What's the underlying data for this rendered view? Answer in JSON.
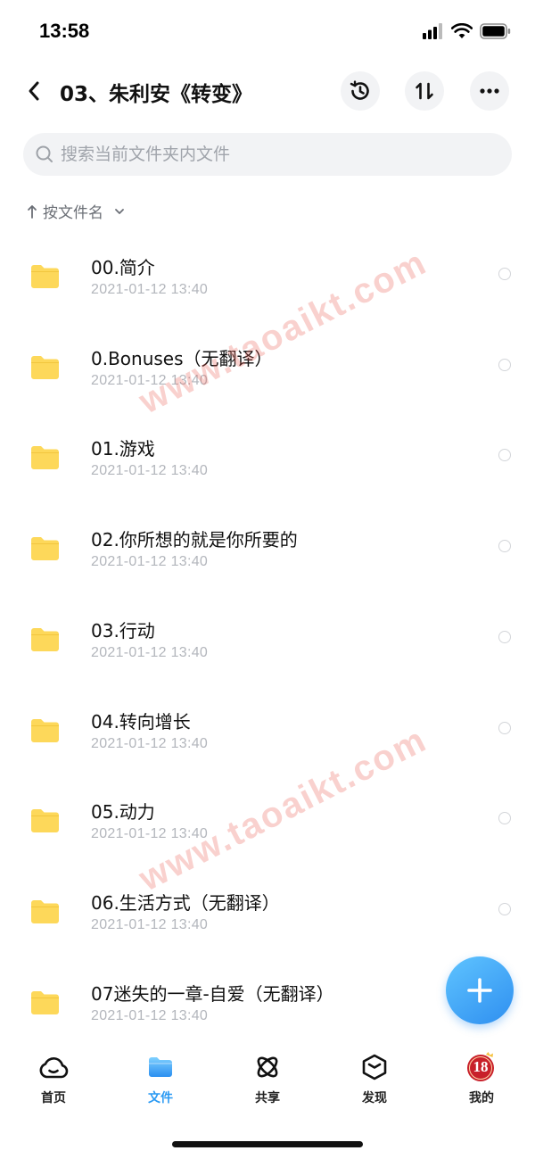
{
  "status_bar": {
    "time": "13:58"
  },
  "header": {
    "title": "03、朱利安《转变》"
  },
  "search": {
    "placeholder": "搜索当前文件夹内文件"
  },
  "sort": {
    "label": "按文件名"
  },
  "files": [
    {
      "name": "00.简介",
      "date": "2021-01-12 13:40"
    },
    {
      "name": "0.Bonuses（无翻译）",
      "date": "2021-01-12 13:40"
    },
    {
      "name": "01.游戏",
      "date": "2021-01-12 13:40"
    },
    {
      "name": "02.你所想的就是你所要的",
      "date": "2021-01-12 13:40"
    },
    {
      "name": "03.行动",
      "date": "2021-01-12 13:40"
    },
    {
      "name": "04.转向增长",
      "date": "2021-01-12 13:40"
    },
    {
      "name": "05.动力",
      "date": "2021-01-12 13:40"
    },
    {
      "name": "06.生活方式（无翻译）",
      "date": "2021-01-12 13:40"
    },
    {
      "name": "07迷失的一章-自爱（无翻译）",
      "date": "2021-01-12 13:40"
    }
  ],
  "watermark": {
    "text": "www.taoaikt.com"
  },
  "tabs": [
    {
      "label": "首页",
      "icon": "cloud-home-icon",
      "active": false
    },
    {
      "label": "文件",
      "icon": "folder-icon",
      "active": true
    },
    {
      "label": "共享",
      "icon": "atom-share-icon",
      "active": false
    },
    {
      "label": "发现",
      "icon": "discover-box-icon",
      "active": false
    },
    {
      "label": "我的",
      "icon": "avatar-icon",
      "active": false
    }
  ],
  "profile": {
    "avatar_text": "18"
  },
  "colors": {
    "accent": "#2b9af3",
    "folder": "#fdd85a",
    "watermark": "#eb5a50"
  }
}
